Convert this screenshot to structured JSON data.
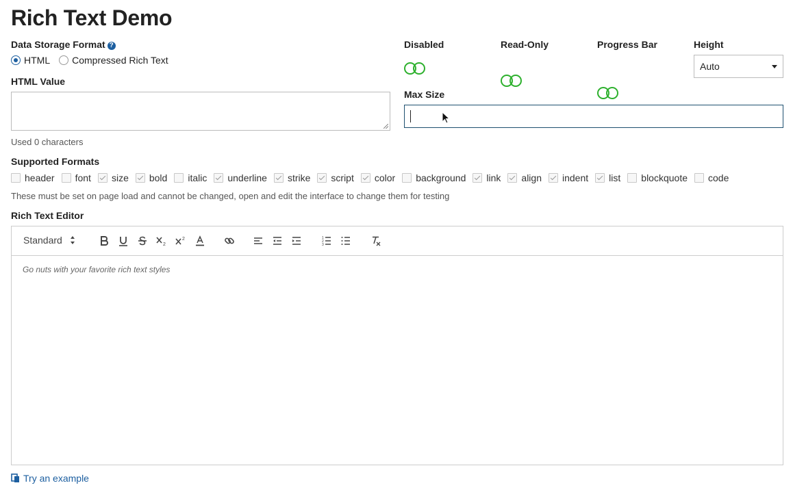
{
  "page": {
    "title": "Rich Text Demo"
  },
  "storage": {
    "label": "Data Storage Format",
    "options": [
      {
        "label": "HTML",
        "selected": true
      },
      {
        "label": "Compressed Rich Text",
        "selected": false
      }
    ]
  },
  "html_value": {
    "label": "HTML Value",
    "value": "",
    "usage": "Used 0 characters"
  },
  "toggles": [
    {
      "label": "Disabled",
      "on": false
    },
    {
      "label": "Read-Only",
      "on": false
    },
    {
      "label": "Progress Bar",
      "on": false
    }
  ],
  "height": {
    "label": "Height",
    "value": "Auto"
  },
  "max_size": {
    "label": "Max Size",
    "value": ""
  },
  "formats": {
    "label": "Supported Formats",
    "items": [
      {
        "label": "header",
        "checked": false
      },
      {
        "label": "font",
        "checked": false
      },
      {
        "label": "size",
        "checked": true
      },
      {
        "label": "bold",
        "checked": true
      },
      {
        "label": "italic",
        "checked": false
      },
      {
        "label": "underline",
        "checked": true
      },
      {
        "label": "strike",
        "checked": true
      },
      {
        "label": "script",
        "checked": true
      },
      {
        "label": "color",
        "checked": true
      },
      {
        "label": "background",
        "checked": false
      },
      {
        "label": "link",
        "checked": true
      },
      {
        "label": "align",
        "checked": true
      },
      {
        "label": "indent",
        "checked": true
      },
      {
        "label": "list",
        "checked": true
      },
      {
        "label": "blockquote",
        "checked": false
      },
      {
        "label": "code",
        "checked": false
      }
    ],
    "note": "These must be set on page load and cannot be changed, open and edit the interface to change them for testing"
  },
  "editor": {
    "label": "Rich Text Editor",
    "size_select": "Standard",
    "placeholder": "Go nuts with your favorite rich text styles",
    "tools": [
      "bold-icon",
      "underline-icon",
      "strike-icon",
      "subscript-icon",
      "superscript-icon",
      "text-color-icon",
      "link-icon",
      "align-left-icon",
      "outdent-icon",
      "indent-icon",
      "ordered-list-icon",
      "bullet-list-icon",
      "clear-format-icon"
    ]
  },
  "example_link": {
    "label": "Try an example",
    "icon": "clipboard-icon"
  },
  "colors": {
    "accent": "#1d5fa0",
    "toggle": "#2db02d",
    "focus_border": "#1d4f6f"
  }
}
